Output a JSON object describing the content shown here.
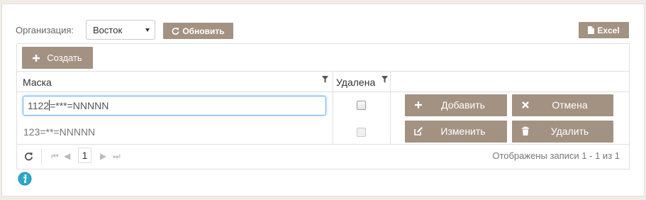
{
  "toolbar": {
    "org_label": "Организация:",
    "org_value": "Восток",
    "refresh_label": "Обновить",
    "excel_label": "Excel"
  },
  "grid": {
    "create_label": "Создать",
    "columns": [
      "Маска",
      "Удалена"
    ],
    "rows": [
      {
        "mask_before_cursor": "1122",
        "mask_after_cursor": "=***=NNNNN",
        "deleted": false,
        "editing": true
      },
      {
        "mask": "123=**=NNNNN",
        "deleted": false,
        "editing": false
      }
    ],
    "actions": {
      "add": "Добавить",
      "cancel": "Отмена",
      "edit": "Изменить",
      "delete": "Удалить"
    },
    "pager": {
      "current_page": "1",
      "summary": "Отображены записи 1 - 1 из 1"
    }
  },
  "colors": {
    "accent": "#a39282",
    "background": "#f1ece6",
    "focus_border": "#66afe9",
    "info_icon": "#2aa7c9"
  },
  "icons": [
    "refresh-icon",
    "file-icon",
    "plus-icon",
    "filter-icon",
    "edit-icon",
    "times-icon",
    "trash-icon",
    "first-page-icon",
    "prev-page-icon",
    "next-page-icon",
    "last-page-icon",
    "info-icon"
  ]
}
